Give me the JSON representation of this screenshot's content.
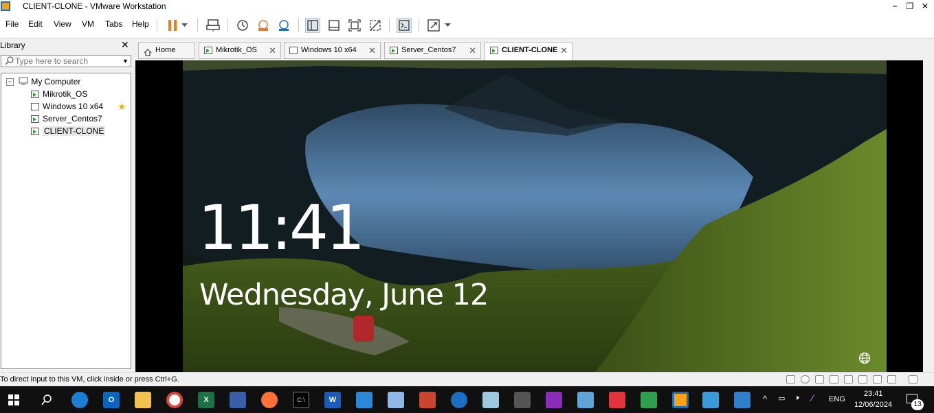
{
  "window": {
    "title": "CLIENT-CLONE - VMware Workstation",
    "minimize": "−",
    "maximize": "❐",
    "close": "✕"
  },
  "menu": [
    "File",
    "Edit",
    "View",
    "VM",
    "Tabs",
    "Help"
  ],
  "library": {
    "header": "Library",
    "close": "✕",
    "search_placeholder": "Type here to search",
    "tree_root": "My Computer",
    "items": [
      {
        "label": "Mikrotik_OS",
        "favorite": false
      },
      {
        "label": "Windows 10 x64",
        "favorite": true
      },
      {
        "label": "Server_Centos7",
        "favorite": false
      },
      {
        "label": "CLIENT-CLONE",
        "favorite": false,
        "selected": true
      }
    ]
  },
  "tabs": [
    {
      "label": "Home",
      "icon": "home-icon"
    },
    {
      "label": "Mikrotik_OS",
      "icon": "vm-running-icon"
    },
    {
      "label": "Windows 10 x64",
      "icon": "vm-icon"
    },
    {
      "label": "Server_Centos7",
      "icon": "vm-running-icon"
    },
    {
      "label": "CLIENT-CLONE",
      "icon": "vm-running-icon",
      "active": true
    }
  ],
  "lockscreen": {
    "time": "11:41",
    "date": "Wednesday, June 12"
  },
  "status": {
    "text": "To direct input to this VM, click inside or press Ctrl+G."
  },
  "tray": {
    "language": "ENG",
    "time": "23:41",
    "date": "12/06/2024",
    "notifications": "13"
  },
  "colors": {
    "accent_pause": "#f07c1c",
    "taskbar": "#101010"
  }
}
